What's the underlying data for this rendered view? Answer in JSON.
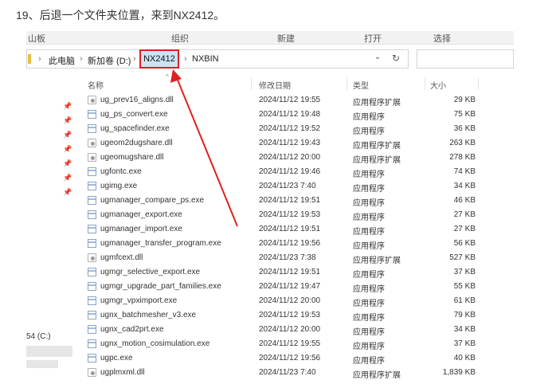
{
  "caption": "19、后退一个文件夹位置，来到NX2412。",
  "ribbon": {
    "left": "山板",
    "items": [
      "组织",
      "新建",
      "打开",
      "选择"
    ]
  },
  "address": {
    "crumbs": [
      "此电脑",
      "新加卷 (D:)",
      "NX2412",
      "NXBIN"
    ],
    "highlighted_crumb": "NX2412",
    "dropdown_icon": "⌄",
    "refresh_icon": "↻"
  },
  "columns": {
    "name": "名称",
    "date": "修改日期",
    "type": "类型",
    "size": "大小"
  },
  "left_pane": {
    "drive": "54 (C:)"
  },
  "files": [
    {
      "name": "ug_prev16_aligns.dll",
      "date": "2024/11/12 19:55",
      "type": "应用程序扩展",
      "size": "29 KB",
      "kind": "dll"
    },
    {
      "name": "ug_ps_convert.exe",
      "date": "2024/11/12 19:48",
      "type": "应用程序",
      "size": "75 KB",
      "kind": "exe"
    },
    {
      "name": "ug_spacefinder.exe",
      "date": "2024/11/12 19:52",
      "type": "应用程序",
      "size": "36 KB",
      "kind": "exe"
    },
    {
      "name": "ugeom2dugshare.dll",
      "date": "2024/11/12 19:43",
      "type": "应用程序扩展",
      "size": "263 KB",
      "kind": "dll"
    },
    {
      "name": "ugeomugshare.dll",
      "date": "2024/11/12 20:00",
      "type": "应用程序扩展",
      "size": "278 KB",
      "kind": "dll"
    },
    {
      "name": "ugfontc.exe",
      "date": "2024/11/12 19:46",
      "type": "应用程序",
      "size": "74 KB",
      "kind": "exe"
    },
    {
      "name": "ugimg.exe",
      "date": "2024/11/23 7:40",
      "type": "应用程序",
      "size": "34 KB",
      "kind": "exe"
    },
    {
      "name": "ugmanager_compare_ps.exe",
      "date": "2024/11/12 19:51",
      "type": "应用程序",
      "size": "46 KB",
      "kind": "exe"
    },
    {
      "name": "ugmanager_export.exe",
      "date": "2024/11/12 19:53",
      "type": "应用程序",
      "size": "27 KB",
      "kind": "exe"
    },
    {
      "name": "ugmanager_import.exe",
      "date": "2024/11/12 19:51",
      "type": "应用程序",
      "size": "27 KB",
      "kind": "exe"
    },
    {
      "name": "ugmanager_transfer_program.exe",
      "date": "2024/11/12 19:56",
      "type": "应用程序",
      "size": "56 KB",
      "kind": "exe"
    },
    {
      "name": "ugmfcext.dll",
      "date": "2024/11/23 7:38",
      "type": "应用程序扩展",
      "size": "527 KB",
      "kind": "dll"
    },
    {
      "name": "ugmgr_selective_export.exe",
      "date": "2024/11/12 19:51",
      "type": "应用程序",
      "size": "37 KB",
      "kind": "exe"
    },
    {
      "name": "ugmgr_upgrade_part_families.exe",
      "date": "2024/11/12 19:47",
      "type": "应用程序",
      "size": "55 KB",
      "kind": "exe"
    },
    {
      "name": "ugmgr_vpximport.exe",
      "date": "2024/11/12 20:00",
      "type": "应用程序",
      "size": "61 KB",
      "kind": "exe"
    },
    {
      "name": "ugnx_batchmesher_v3.exe",
      "date": "2024/11/12 19:53",
      "type": "应用程序",
      "size": "79 KB",
      "kind": "exe"
    },
    {
      "name": "ugnx_cad2prt.exe",
      "date": "2024/11/12 20:00",
      "type": "应用程序",
      "size": "34 KB",
      "kind": "exe"
    },
    {
      "name": "ugnx_motion_cosimulation.exe",
      "date": "2024/11/12 19:55",
      "type": "应用程序",
      "size": "37 KB",
      "kind": "exe"
    },
    {
      "name": "ugpc.exe",
      "date": "2024/11/12 19:56",
      "type": "应用程序",
      "size": "40 KB",
      "kind": "exe"
    },
    {
      "name": "ugplmxml.dll",
      "date": "2024/11/23 7:40",
      "type": "应用程序扩展",
      "size": "1,839 KB",
      "kind": "dll"
    }
  ],
  "colors": {
    "highlight_border": "#e02020",
    "arrow": "#e02020",
    "crumb_selected_bg": "#cde4f7"
  }
}
